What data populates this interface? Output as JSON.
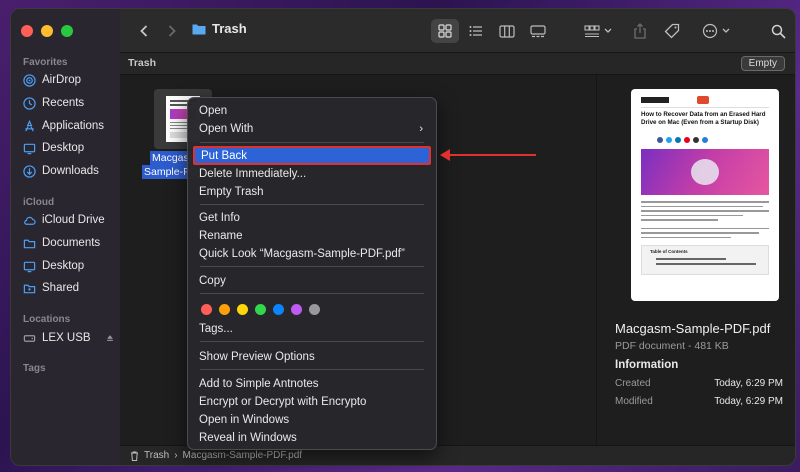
{
  "sidebar": {
    "favorites_label": "Favorites",
    "icloud_label": "iCloud",
    "locations_label": "Locations",
    "tags_label": "Tags",
    "favorites": [
      {
        "label": "AirDrop",
        "icon": "airdrop-icon"
      },
      {
        "label": "Recents",
        "icon": "clock-icon"
      },
      {
        "label": "Applications",
        "icon": "applications-icon"
      },
      {
        "label": "Desktop",
        "icon": "desktop-icon"
      },
      {
        "label": "Downloads",
        "icon": "downloads-icon"
      }
    ],
    "icloud": [
      {
        "label": "iCloud Drive",
        "icon": "cloud-icon"
      },
      {
        "label": "Documents",
        "icon": "folder-icon"
      },
      {
        "label": "Desktop",
        "icon": "desktop-icon"
      },
      {
        "label": "Shared",
        "icon": "shared-folder-icon"
      }
    ],
    "locations": [
      {
        "label": "LEX USB",
        "icon": "drive-icon"
      }
    ]
  },
  "toolbar": {
    "title": "Trash"
  },
  "pathbar": {
    "location": "Trash",
    "empty_label": "Empty"
  },
  "file": {
    "label_line1": "Macgasm",
    "label_line2": "Sample-PD"
  },
  "context_menu": {
    "open": "Open",
    "open_with": "Open With",
    "put_back": "Put Back",
    "delete_immediately": "Delete Immediately...",
    "empty_trash": "Empty Trash",
    "get_info": "Get Info",
    "rename": "Rename",
    "quick_look": "Quick Look “Macgasm-Sample-PDF.pdf”",
    "copy": "Copy",
    "tags": "Tags...",
    "show_preview_options": "Show Preview Options",
    "add_to_antnotes": "Add to Simple Antnotes",
    "encrypt": "Encrypt or Decrypt with Encrypto",
    "open_in_windows": "Open in Windows",
    "reveal_in_windows": "Reveal in Windows",
    "tag_colors": [
      "#ff5f57",
      "#ff9f0a",
      "#ffd60a",
      "#32d74b",
      "#0a84ff",
      "#bf5af2",
      "#98989d"
    ]
  },
  "preview": {
    "doc_title": "How to Recover Data from an Erased Hard Drive on Mac (Even from a Startup Disk)",
    "toc_label": "Table of Contents",
    "name": "Macgasm-Sample-PDF.pdf",
    "type": "PDF document - 481 KB",
    "info_label": "Information",
    "created_label": "Created",
    "created_value": "Today, 6:29 PM",
    "modified_label": "Modified",
    "modified_value": "Today, 6:29 PM"
  },
  "bottombar": {
    "crumb1": "Trash",
    "crumb2": "Macgasm-Sample-PDF.pdf"
  },
  "colors": {
    "accent": "#2c63d6",
    "highlight_box": "#e03030"
  }
}
